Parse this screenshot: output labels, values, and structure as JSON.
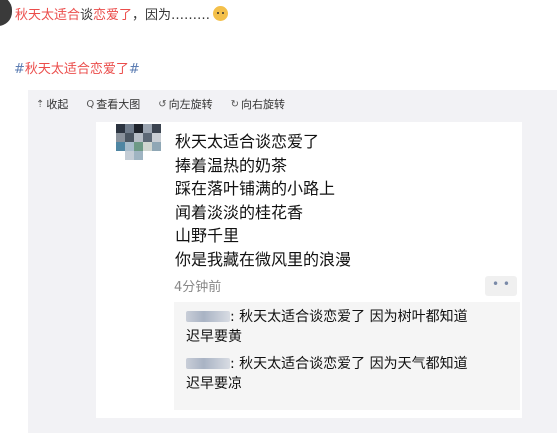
{
  "post": {
    "part1": "秋天太适合",
    "part2": "谈",
    "part3": "恋爱了",
    "part4": "，因为………",
    "emoji": "dog-face-icon"
  },
  "hashtag": {
    "open": "#",
    "text": "秋天太适合恋爱了",
    "close": "#"
  },
  "toolbar": {
    "collapse": "收起",
    "view_large": "查看大图",
    "rotate_left": "向左旋转",
    "rotate_right": "向右旋转"
  },
  "image": {
    "poem": [
      "秋天太适合谈恋爱了",
      "捧着温热的奶茶",
      "踩在落叶铺满的小路上",
      "闻着淡淡的桂花香",
      "山野千里",
      "你是我藏在微风里的浪漫"
    ],
    "time": "4分钟前",
    "more": "• •",
    "comments": [
      {
        "line1": ": 秋天太适合谈恋爱了 因为树叶都知道",
        "line2": "迟早要黄"
      },
      {
        "line1": ": 秋天太适合谈恋爱了 因为天气都知道",
        "line2": "迟早要凉"
      }
    ]
  },
  "colors": {
    "accent_red": "#eb4d4b",
    "hash_blue": "#5c7db3",
    "panel_bg": "#f2f2f5"
  }
}
